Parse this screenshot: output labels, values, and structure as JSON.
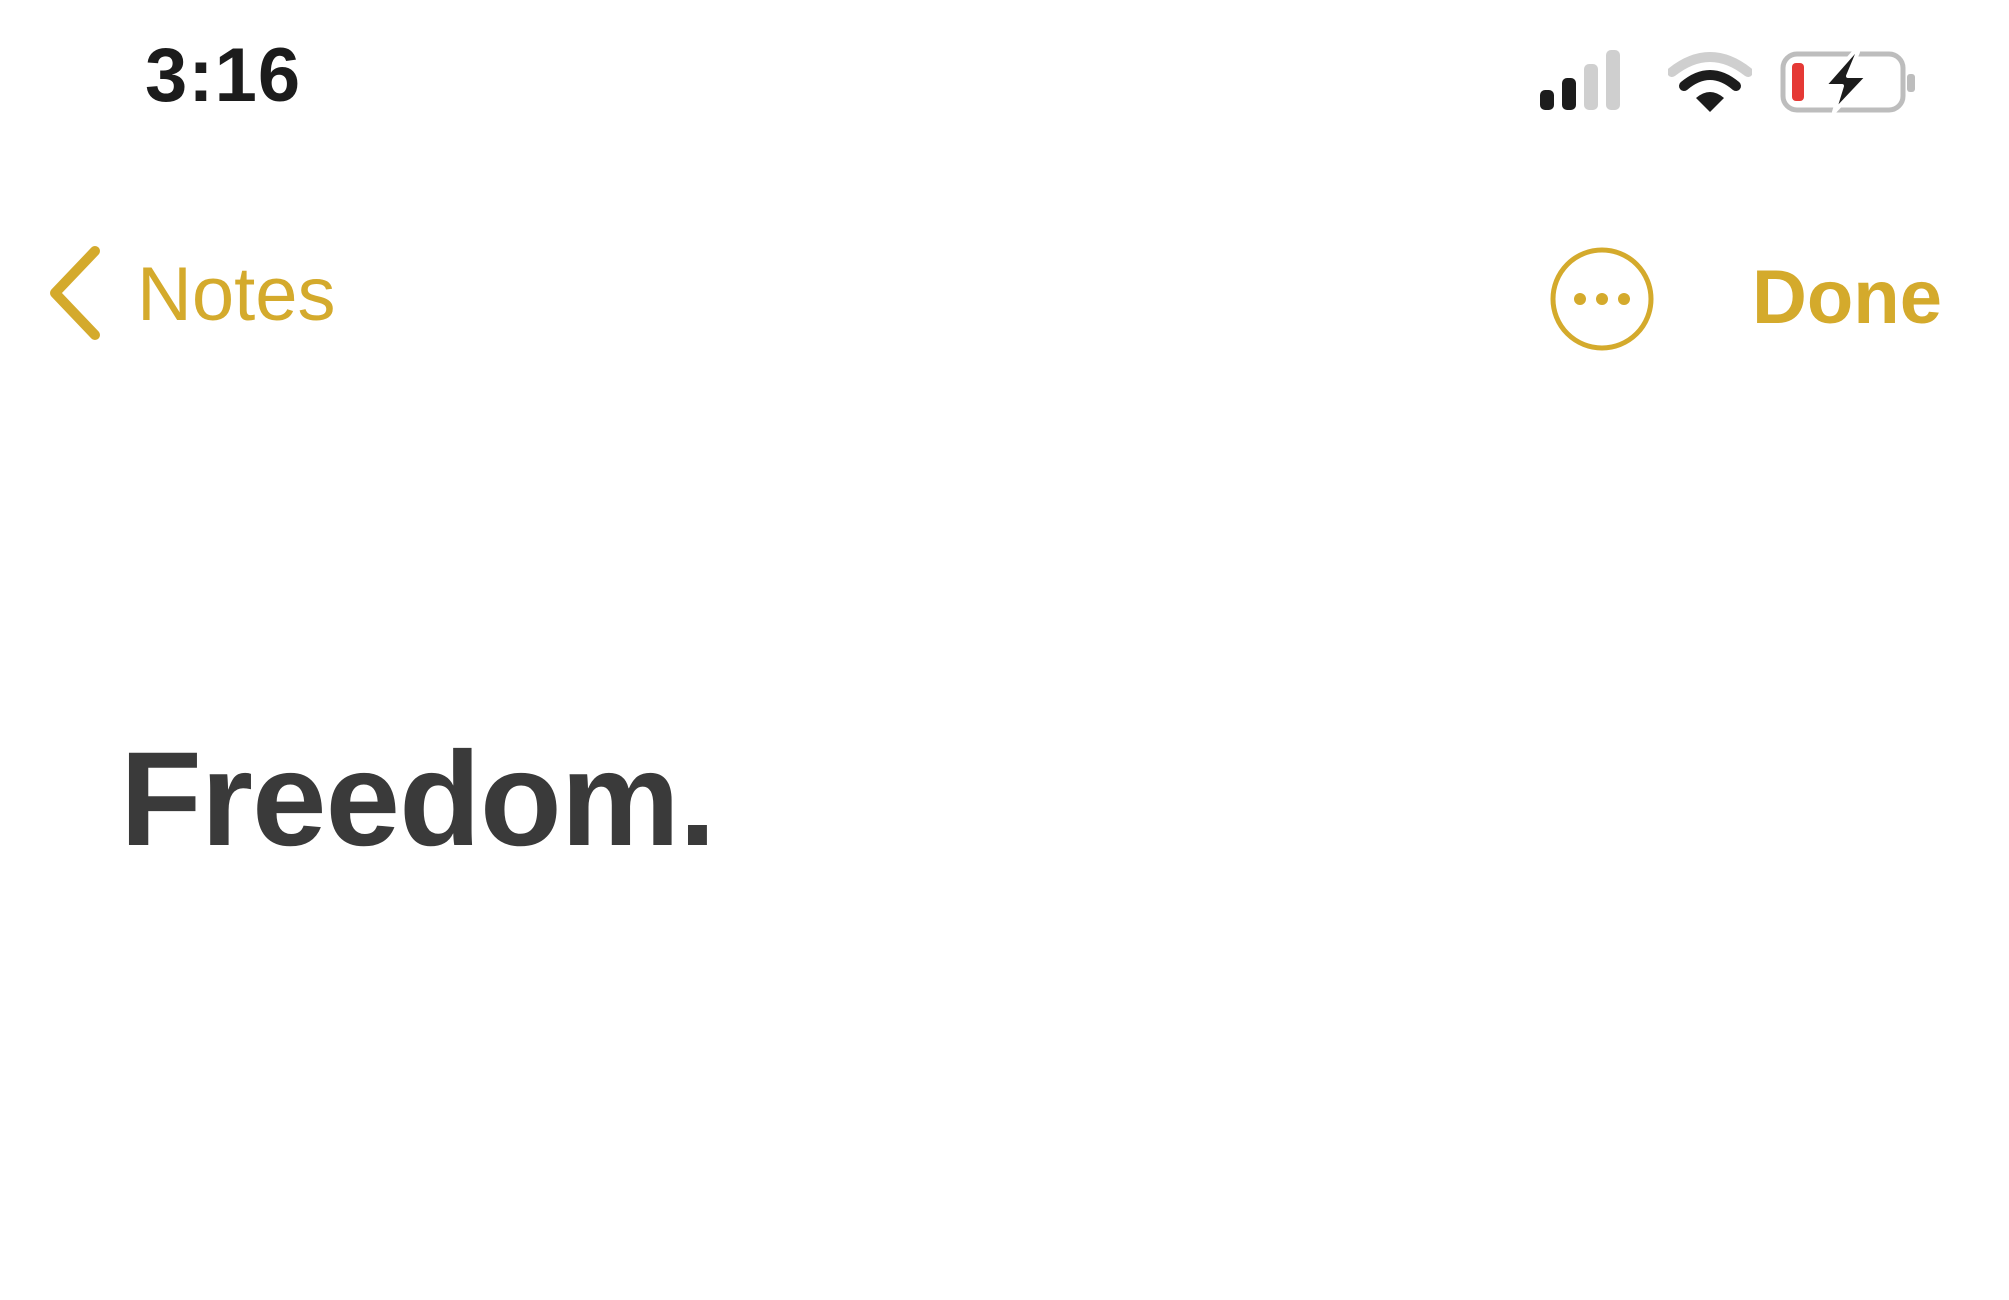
{
  "status_bar": {
    "time": "3:16",
    "icons": [
      "cellular-signal-icon",
      "wifi-icon",
      "battery-charging-icon"
    ]
  },
  "nav": {
    "back_label": "Notes",
    "back_icon": "chevron-left-icon",
    "more_icon": "ellipsis-circle-icon",
    "done_label": "Done"
  },
  "note": {
    "title": "Freedom."
  },
  "colors": {
    "accent": "#d4aa2c",
    "text": "#3a3a3a",
    "status_text": "#1c1c1c",
    "battery_low": "#e53935"
  }
}
